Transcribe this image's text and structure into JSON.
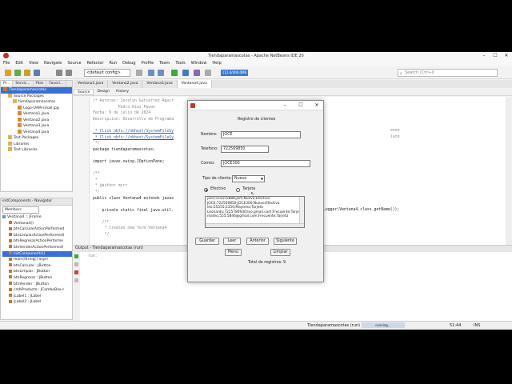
{
  "window": {
    "title": "Tiendaparamascotas - Apache NetBeans IDE 20"
  },
  "menu": [
    "File",
    "Edit",
    "View",
    "Navigate",
    "Source",
    "Refactor",
    "Run",
    "Debug",
    "Profile",
    "Team",
    "Tools",
    "Window",
    "Help"
  ],
  "toolbar": {
    "config": "<default config>",
    "memory": "112.0/406.0MB",
    "search_placeholder": "Search (Ctrl+I)"
  },
  "projects_panel": {
    "tabs": [
      "Pr...",
      "Servic...",
      "Files",
      "Favori..."
    ],
    "tree": [
      {
        "label": "Tiendaparamascotas",
        "level": 0,
        "selected": true
      },
      {
        "label": "Source Packages",
        "level": 1
      },
      {
        "label": "tiendaparamascotas",
        "level": 2
      },
      {
        "label": "Logo-UAM-small.jpg",
        "level": 3
      },
      {
        "label": "Ventana1.java",
        "level": 3
      },
      {
        "label": "Ventana2.java",
        "level": 3
      },
      {
        "label": "Ventana3.java",
        "level": 3
      },
      {
        "label": "Ventana4.java",
        "level": 3
      },
      {
        "label": "Test Packages",
        "level": 1
      },
      {
        "label": "Libraries",
        "level": 1
      },
      {
        "label": "Test Libraries",
        "level": 1
      }
    ]
  },
  "navigator": {
    "title": "initComponents - Navigator",
    "filter": "Members",
    "root": "Ventana4 :: JFrame",
    "items": [
      "Ventana4()",
      "btnCalcularActionPerformed",
      "btnLimpiarActionPerformed(",
      "btnRegresarActionPerforme",
      "btnVenderActionPerformed(",
      "initComponents()",
      "main(String[] args)",
      "btnCalcular : JButton",
      "btnLimpiar : JButton",
      "btnRegresar : JButton",
      "btnVender : JButton",
      "cmbProducto : JComboBox<",
      "jLabel1 : JLabel",
      "jLabel2 : JLabel"
    ],
    "selected_index": 5
  },
  "editor": {
    "tabs": [
      "Ventana1.java",
      "Ventana2.java",
      "Ventana3.java",
      "Ventana4.java"
    ],
    "active_tab": 3,
    "subtabs": [
      "Source",
      "Design",
      "History"
    ],
    "lines": [
      {
        "t": "/* Autoras: Jocelyn Gutierrez Aguir",
        "c": "com"
      },
      {
        "t": "           Pedro Diaz Pavon",
        "c": "com"
      },
      {
        "t": "Fecha: 8 de julio de 2024",
        "c": "com"
      },
      {
        "t": "Descripcion: Desarrollo de Programa",
        "c": "com"
      },
      {
        "t": "",
        "c": "com"
      },
      {
        "t": " * Click nbfs://nbhost/SystemFileSy",
        "c": "link"
      },
      {
        "t": " * Click nbfs://nbhost/SystemFileSy",
        "c": "link"
      },
      {
        "t": " */",
        "c": "com"
      },
      {
        "t": "package tiendaparamascotas;",
        "c": "plain"
      },
      {
        "t": "",
        "c": "com"
      },
      {
        "t": "import javax.swing.JOptionPane;",
        "c": "plain"
      },
      {
        "t": "",
        "c": "com"
      },
      {
        "t": "/**",
        "c": "com"
      },
      {
        "t": " *",
        "c": "com"
      },
      {
        "t": " * @author mcrr",
        "c": "com"
      },
      {
        "t": " */",
        "c": "com"
      },
      {
        "t": "public class Ventana4 extends javax",
        "c": "plain"
      },
      {
        "t": "",
        "c": "com"
      },
      {
        "t": "    private static final java.util.",
        "c": "plain"
      },
      {
        "t": "",
        "c": "com"
      },
      {
        "t": "    /**",
        "c": "com"
      },
      {
        "t": "     * Creates new form Ventana4",
        "c": "com"
      },
      {
        "t": "     */",
        "c": "com"
      }
    ],
    "right_fragments": [
      "ense",
      "late",
      "Logger(Ventana4.class.getName());"
    ]
  },
  "output": {
    "title": "Output - Tiendaparamascotas (run)",
    "line": "run:"
  },
  "status": {
    "task": "Tiendaparamascotas (run)",
    "state": "running...",
    "position": "51:44",
    "mode": "INS"
  },
  "dialog": {
    "heading": "Registro de clientes",
    "fields": [
      {
        "label": "Nombre:",
        "value": "JOCE"
      },
      {
        "label": "Telefono:",
        "value": "722569850"
      },
      {
        "label": "Correo:",
        "value": "JOCE300"
      }
    ],
    "client_type_label": "Tipo de cliente:",
    "client_type_value": "Nuevo",
    "payment": [
      {
        "label": "Efectivo",
        "selected": true
      },
      {
        "label": "Tarjeta",
        "selected": false
      }
    ],
    "records": [
      "joce;555555888;jkm;Nuevo;Efectivo",
      "JOCE;722569850;JOCE300;Nuevo;Efectivo",
      "leo;55555;2350;Mayoreo;Tarjeta",
      "Leonardo;7225786930;leo.gmail.com;Frecuente;Tarjeta",
      "mateo;555;5846@gmail.com;Frecuente;Tarjeta"
    ],
    "buttons": {
      "save": "Guardar",
      "read": "Leer",
      "prev": "Anterior",
      "next": "Siguiente",
      "menu": "Menú",
      "clear": "Limpiar"
    },
    "total_label": "Total de registros:",
    "total_value": "9"
  }
}
